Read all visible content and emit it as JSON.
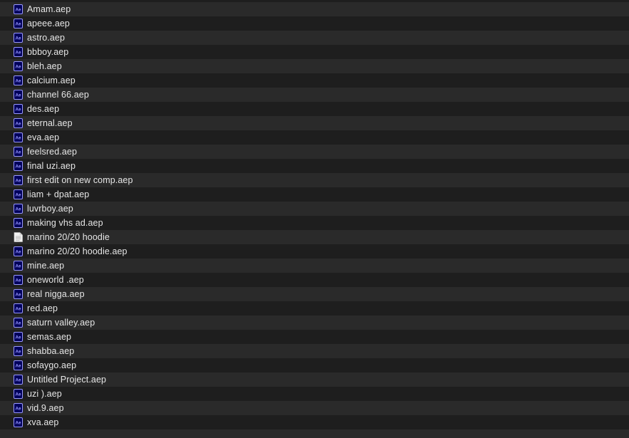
{
  "files": [
    {
      "name": "Amam.aep",
      "icon": "after-effects-file-icon"
    },
    {
      "name": "apeee.aep",
      "icon": "after-effects-file-icon"
    },
    {
      "name": "astro.aep",
      "icon": "after-effects-file-icon"
    },
    {
      "name": "bbboy.aep",
      "icon": "after-effects-file-icon"
    },
    {
      "name": "bleh.aep",
      "icon": "after-effects-file-icon"
    },
    {
      "name": "calcium.aep",
      "icon": "after-effects-file-icon"
    },
    {
      "name": "channel 66.aep",
      "icon": "after-effects-file-icon"
    },
    {
      "name": "des.aep",
      "icon": "after-effects-file-icon"
    },
    {
      "name": "eternal.aep",
      "icon": "after-effects-file-icon"
    },
    {
      "name": "eva.aep",
      "icon": "after-effects-file-icon"
    },
    {
      "name": "feelsred.aep",
      "icon": "after-effects-file-icon"
    },
    {
      "name": "final uzi.aep",
      "icon": "after-effects-file-icon"
    },
    {
      "name": "first edit on new comp.aep",
      "icon": "after-effects-file-icon"
    },
    {
      "name": "liam + dpat.aep",
      "icon": "after-effects-file-icon"
    },
    {
      "name": "luvrboy.aep",
      "icon": "after-effects-file-icon"
    },
    {
      "name": "making vhs ad.aep",
      "icon": "after-effects-file-icon"
    },
    {
      "name": "marino 20/20 hoodie",
      "icon": "document-file-icon"
    },
    {
      "name": "marino 20/20 hoodie.aep",
      "icon": "after-effects-file-icon"
    },
    {
      "name": "mine.aep",
      "icon": "after-effects-file-icon"
    },
    {
      "name": "oneworld .aep",
      "icon": "after-effects-file-icon"
    },
    {
      "name": "real nigga.aep",
      "icon": "after-effects-file-icon"
    },
    {
      "name": "red.aep",
      "icon": "after-effects-file-icon"
    },
    {
      "name": "saturn valley.aep",
      "icon": "after-effects-file-icon"
    },
    {
      "name": "semas.aep",
      "icon": "after-effects-file-icon"
    },
    {
      "name": "shabba.aep",
      "icon": "after-effects-file-icon"
    },
    {
      "name": "sofaygo.aep",
      "icon": "after-effects-file-icon"
    },
    {
      "name": "Untitled Project.aep",
      "icon": "after-effects-file-icon"
    },
    {
      "name": "uzi ).aep",
      "icon": "after-effects-file-icon"
    },
    {
      "name": "vid.9.aep",
      "icon": "after-effects-file-icon"
    },
    {
      "name": "xva.aep",
      "icon": "after-effects-file-icon"
    }
  ],
  "colors": {
    "row_odd": "#2a2a2a",
    "row_even": "#1e1e1e",
    "text": "#e6e6e6",
    "ae_icon_bg": "#00005b",
    "ae_icon_border": "#9999ff"
  }
}
